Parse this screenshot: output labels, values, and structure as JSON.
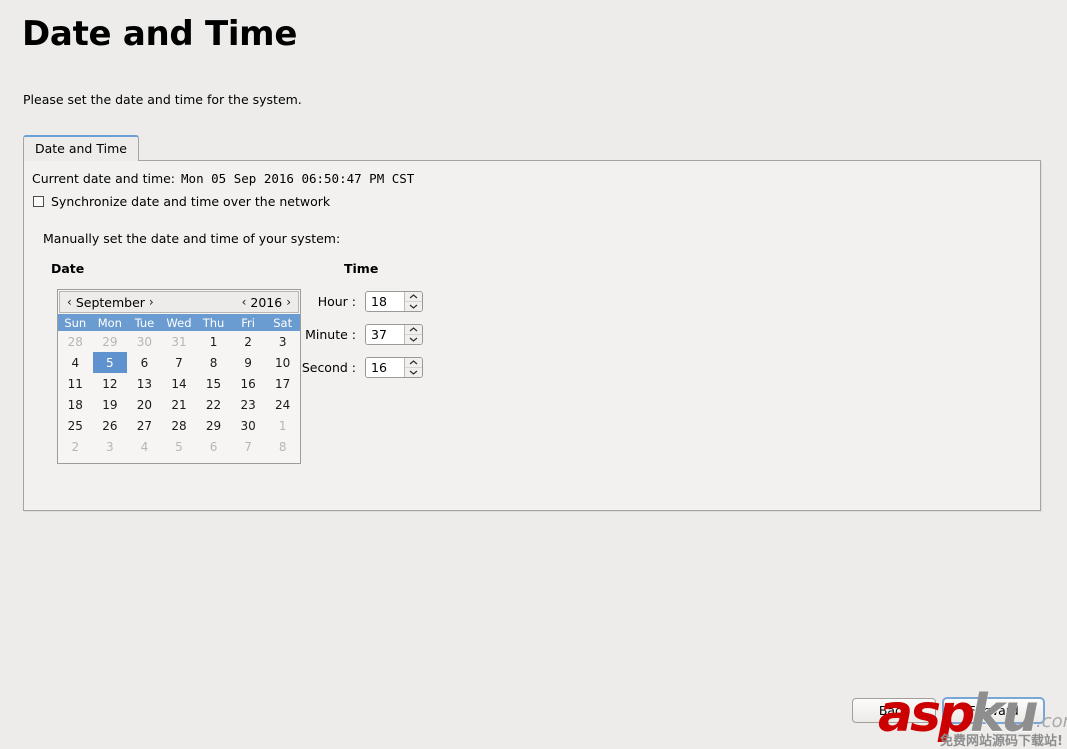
{
  "page": {
    "title": "Date and Time",
    "subtitle": "Please set the date and time for the system."
  },
  "tab": {
    "label": "Date and Time"
  },
  "panel": {
    "current_label": "Current date and time:",
    "current_value": "Mon 05 Sep 2016 06:50:47 PM CST",
    "sync_checkbox_label": "Synchronize date and time over the network",
    "sync_checked": false,
    "manual_label": "Manually set the date and time of your system:",
    "date_section_title": "Date",
    "time_section_title": "Time"
  },
  "calendar": {
    "prev_month_arrow": "‹",
    "next_month_arrow": "›",
    "month": "September",
    "prev_year_arrow": "‹",
    "next_year_arrow": "›",
    "year": "2016",
    "weekday_headers": [
      "Sun",
      "Mon",
      "Tue",
      "Wed",
      "Thu",
      "Fri",
      "Sat"
    ],
    "selected_day": 5,
    "weeks": [
      [
        {
          "d": "28",
          "other": true
        },
        {
          "d": "29",
          "other": true
        },
        {
          "d": "30",
          "other": true
        },
        {
          "d": "31",
          "other": true
        },
        {
          "d": "1",
          "other": false
        },
        {
          "d": "2",
          "other": false
        },
        {
          "d": "3",
          "other": false
        }
      ],
      [
        {
          "d": "4",
          "other": false
        },
        {
          "d": "5",
          "other": false,
          "selected": true
        },
        {
          "d": "6",
          "other": false
        },
        {
          "d": "7",
          "other": false
        },
        {
          "d": "8",
          "other": false
        },
        {
          "d": "9",
          "other": false
        },
        {
          "d": "10",
          "other": false
        }
      ],
      [
        {
          "d": "11",
          "other": false
        },
        {
          "d": "12",
          "other": false
        },
        {
          "d": "13",
          "other": false
        },
        {
          "d": "14",
          "other": false
        },
        {
          "d": "15",
          "other": false
        },
        {
          "d": "16",
          "other": false
        },
        {
          "d": "17",
          "other": false
        }
      ],
      [
        {
          "d": "18",
          "other": false
        },
        {
          "d": "19",
          "other": false
        },
        {
          "d": "20",
          "other": false
        },
        {
          "d": "21",
          "other": false
        },
        {
          "d": "22",
          "other": false
        },
        {
          "d": "23",
          "other": false
        },
        {
          "d": "24",
          "other": false
        }
      ],
      [
        {
          "d": "25",
          "other": false
        },
        {
          "d": "26",
          "other": false
        },
        {
          "d": "27",
          "other": false
        },
        {
          "d": "28",
          "other": false
        },
        {
          "d": "29",
          "other": false
        },
        {
          "d": "30",
          "other": false
        },
        {
          "d": "1",
          "other": true
        }
      ],
      [
        {
          "d": "2",
          "other": true
        },
        {
          "d": "3",
          "other": true
        },
        {
          "d": "4",
          "other": true
        },
        {
          "d": "5",
          "other": true
        },
        {
          "d": "6",
          "other": true
        },
        {
          "d": "7",
          "other": true
        },
        {
          "d": "8",
          "other": true
        }
      ]
    ]
  },
  "time": {
    "hour_label": "Hour :",
    "hour_value": "18",
    "minute_label": "Minute :",
    "minute_value": "37",
    "second_label": "Second :",
    "second_value": "16",
    "spin_up_glyph": "▲",
    "spin_down_glyph": "▼"
  },
  "footer": {
    "back_label": "Back",
    "forward_label": "Forward"
  },
  "watermark": {
    "part_red": "asp",
    "part_gray": "ku",
    "domain_suffix": ".com",
    "subtitle": "免费网站源码下载站!"
  },
  "colors": {
    "page_background": "#edecea",
    "panel_background": "#f2f1ef",
    "calendar_header_blue": "#6a9bd1",
    "selected_day_blue": "#5f93cf",
    "focus_border_blue": "#7aa6d6",
    "watermark_red": "#cc0000"
  }
}
